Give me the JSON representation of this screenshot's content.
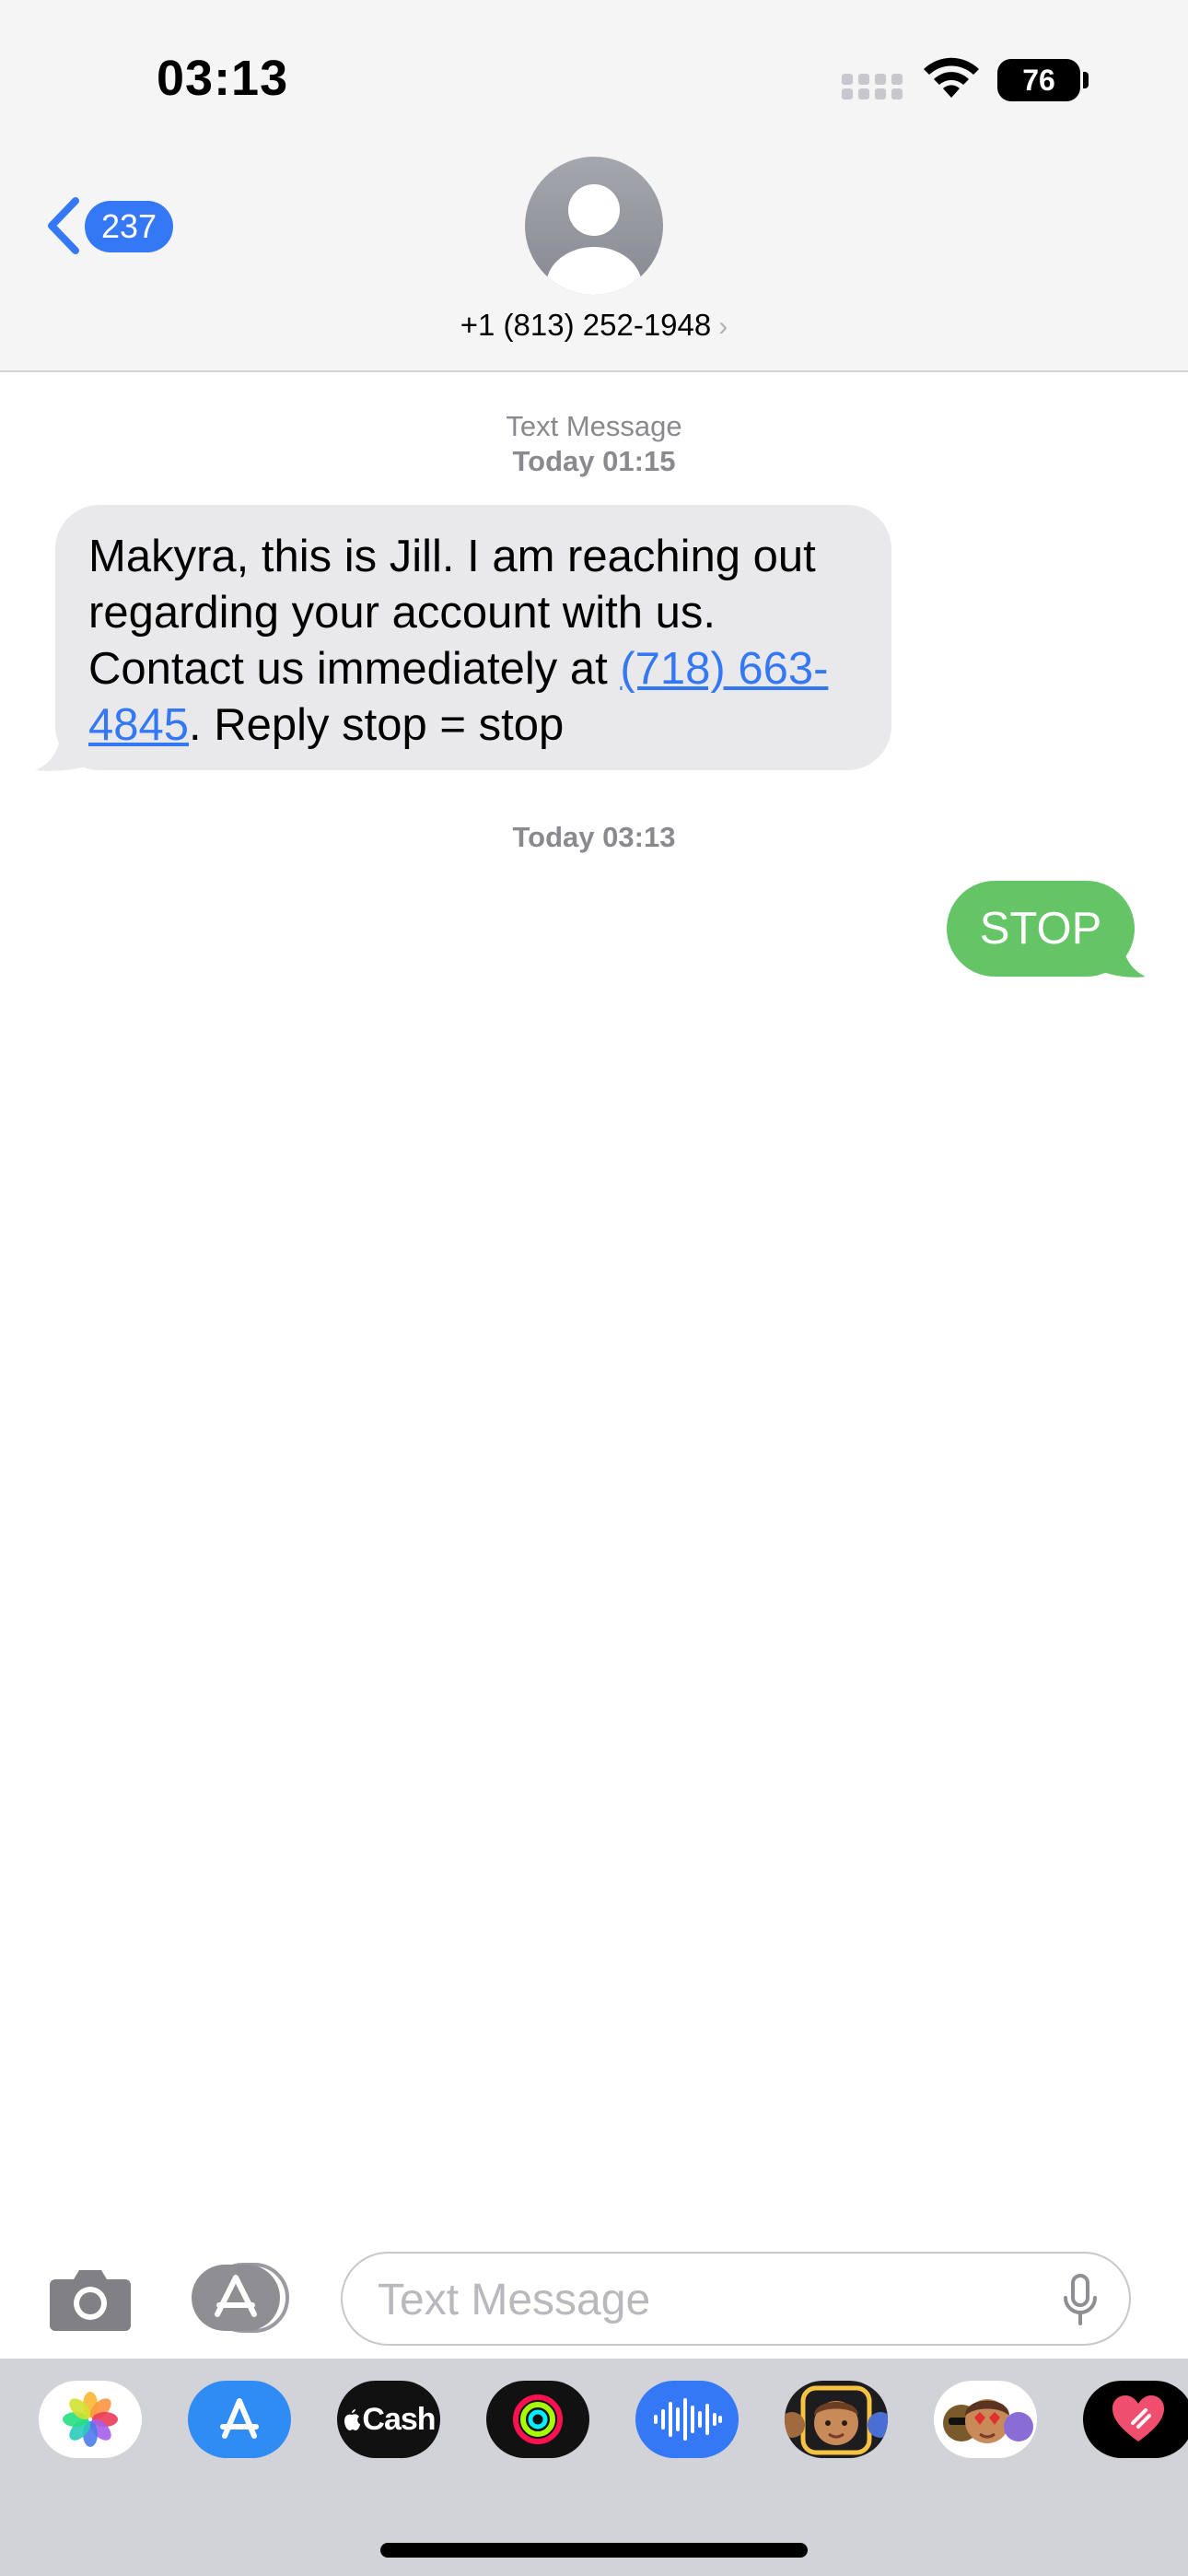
{
  "status_bar": {
    "time": "03:13",
    "battery": "76"
  },
  "nav": {
    "back_count": "237",
    "contact": "+1 (813) 252-1948",
    "contact_chevron": "›"
  },
  "conversation": {
    "stamp1_label": "Text Message",
    "stamp1_time": "Today 01:15",
    "incoming_text_before": "Makyra, this is Jill. I am reaching out regarding your account with us. Contact us immediately at ",
    "incoming_link": "(718) 663-4845",
    "incoming_text_after": ". Reply stop = stop",
    "stamp2_time": "Today 03:13",
    "outgoing_text": "STOP"
  },
  "composer": {
    "placeholder": "Text Message"
  },
  "drawer": {
    "apps": [
      "photos-icon",
      "app-store-icon",
      "apple-cash-icon",
      "activity-icon",
      "audio-message-icon",
      "memoji-stickers-icon",
      "animoji-icon",
      "digital-touch-icon"
    ],
    "cash_label": "Cash"
  },
  "colors": {
    "accent": "#3478f6",
    "outgoing_bubble": "#65c466",
    "incoming_bubble": "#e9e9eb"
  }
}
